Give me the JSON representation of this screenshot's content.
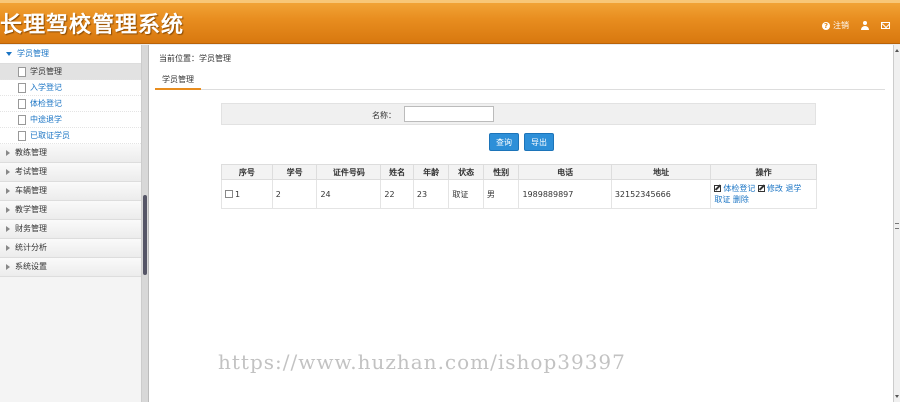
{
  "header": {
    "title": "长理驾校管理系统",
    "logout_label": "注销",
    "help_icon": "help-icon",
    "user_icon": "user-icon",
    "mail_icon": "mail-icon"
  },
  "sidebar": {
    "groups": [
      {
        "label": "学员管理",
        "expanded": true,
        "items": [
          {
            "label": "学员管理",
            "active": true
          },
          {
            "label": "入学登记"
          },
          {
            "label": "体检登记"
          },
          {
            "label": "中途退学"
          },
          {
            "label": "已取证学员"
          }
        ]
      },
      {
        "label": "教练管理"
      },
      {
        "label": "考试管理"
      },
      {
        "label": "车辆管理"
      },
      {
        "label": "教学管理"
      },
      {
        "label": "财务管理"
      },
      {
        "label": "统计分析"
      },
      {
        "label": "系统设置"
      }
    ]
  },
  "main": {
    "breadcrumb": "当前位置：学员管理",
    "tab_label": "学员管理",
    "search": {
      "label": "名称：",
      "value": "",
      "placeholder": ""
    },
    "buttons": {
      "query": "查询",
      "export": "导出"
    },
    "table": {
      "columns": [
        "序号",
        "学号",
        "证件号码",
        "姓名",
        "年龄",
        "状态",
        "性别",
        "电话",
        "地址",
        "操作"
      ],
      "rows": [
        {
          "index": "1",
          "student_no": "2",
          "id_no": "24",
          "name": "22",
          "age": "23",
          "status": "取证",
          "gender": "男",
          "phone": "1989889897",
          "address": "32152345666",
          "actions": {
            "checkup": "体检登记",
            "edit": "修改",
            "withdraw": "退学",
            "certify": "取证",
            "delete": "删除"
          }
        }
      ]
    }
  },
  "watermark": "https://www.huzhan.com/ishop39397",
  "colors": {
    "header": "#e88d1f",
    "accent": "#1a74c4",
    "button": "#2d8fd8"
  }
}
